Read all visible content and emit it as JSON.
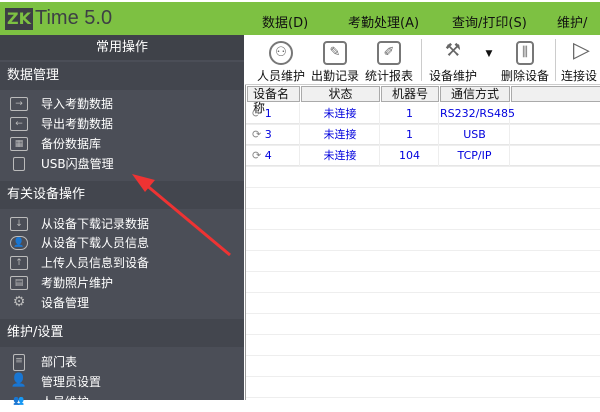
{
  "app": {
    "logo_zk": "ZK",
    "logo_text": "Time 5.0"
  },
  "menu": [
    "数据(D)",
    "考勤处理(A)",
    "查询/打印(S)",
    "维护/设"
  ],
  "sidebar": {
    "title": "常用操作",
    "sections": [
      {
        "label": "数据管理",
        "items": [
          "导入考勤数据",
          "导出考勤数据",
          "备份数据库",
          "USB闪盘管理"
        ]
      },
      {
        "label": "有关设备操作",
        "items": [
          "从设备下载记录数据",
          "从设备下载人员信息",
          "上传人员信息到设备",
          "考勤照片维护",
          "设备管理"
        ]
      },
      {
        "label": "维护/设置",
        "items": [
          "部门表",
          "管理员设置",
          "人员维护"
        ]
      }
    ]
  },
  "toolbar": [
    "人员维护",
    "出勤记录",
    "统计报表",
    "设备维护",
    "删除设备",
    "连接设"
  ],
  "table": {
    "columns": [
      "设备名称",
      "状态",
      "机器号",
      "通信方式"
    ],
    "rows": [
      [
        "1",
        "未连接",
        "1",
        "RS232/RS485"
      ],
      [
        "3",
        "未连接",
        "1",
        "USB"
      ],
      [
        "4",
        "未连接",
        "104",
        "TCP/IP"
      ]
    ]
  },
  "colors": {
    "menubar": "#7dc142",
    "sidebar": "#4b4e57",
    "link": "#0000dd",
    "arrow": "#ee3333"
  }
}
